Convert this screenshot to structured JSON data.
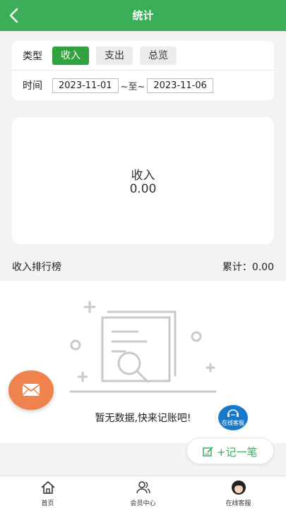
{
  "header": {
    "title": "统计",
    "back_icon": "chevron-left-icon"
  },
  "filter": {
    "type_label": "类型",
    "types": [
      {
        "label": "收入",
        "active": true
      },
      {
        "label": "支出",
        "active": false
      },
      {
        "label": "总览",
        "active": false
      }
    ],
    "time_label": "时间",
    "start_date": "2023-11-01",
    "separator": "~至~",
    "end_date": "2023-11-06"
  },
  "summary": {
    "label": "收入",
    "value": "0.00"
  },
  "ranking": {
    "title": "收入排行榜",
    "total": "累计：0.00"
  },
  "empty_state": {
    "text": "暂无数据,快来记账吧!",
    "icon": "empty-document-search-icon"
  },
  "floating": {
    "mail_icon": "mail-icon",
    "service_text": "在线客服",
    "add_label": "+记一笔",
    "add_icon": "edit-icon"
  },
  "tabbar": {
    "items": [
      {
        "label": "首页",
        "icon": "home-icon"
      },
      {
        "label": "会员中心",
        "icon": "members-icon"
      },
      {
        "label": "在线客服",
        "icon": "service-avatar-icon"
      }
    ]
  },
  "colors": {
    "primary": "#3cae5a",
    "active_chip": "#31a23f",
    "fab": "#f0834d",
    "service": "#1878c9"
  }
}
